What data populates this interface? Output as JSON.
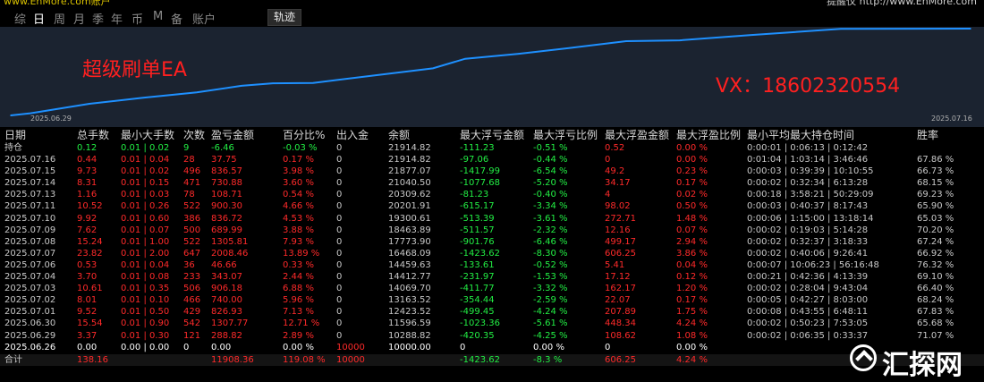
{
  "top": {
    "left_text": "www.EnMore.com账户",
    "right_text": "提醒仪 http://www.EnMore.com",
    "tabs": [
      "综",
      "日",
      "周",
      "月",
      "季",
      "年",
      "币",
      "M",
      "备",
      "账户"
    ],
    "active_tab": "日",
    "track_button": "轨迹"
  },
  "chart": {
    "title": "超级刷单EA",
    "contact": "VX：18602320554",
    "start_date": "2025.06.29",
    "end_date": "2025.07.16"
  },
  "chart_data": {
    "type": "line",
    "series": [
      {
        "values": [
          10000.0,
          10288.82,
          11596.59,
          12423.52,
          13163.52,
          14069.7,
          14412.77,
          14459.63,
          16468.09,
          17773.9,
          18463.89,
          19300.61,
          20201.91,
          20309.62,
          21040.5,
          21877.07,
          21914.82
        ]
      }
    ],
    "x": [
      "2025.06.26",
      "2025.06.29",
      "2025.06.30",
      "2025.07.01",
      "2025.07.02",
      "2025.07.03",
      "2025.07.04",
      "2025.07.06",
      "2025.07.07",
      "2025.07.08",
      "2025.07.09",
      "2025.07.10",
      "2025.07.11",
      "2025.07.13",
      "2025.07.14",
      "2025.07.15",
      "2025.07.16"
    ]
  },
  "table": {
    "headers": [
      "日期",
      "总手数",
      "最小大手数",
      "次数",
      "盈亏金额",
      "百分比%",
      "出入金",
      "余额",
      "最大浮亏金额",
      "最大浮亏比例",
      "最大浮盈金额",
      "最大浮盈比例",
      "最小平均最大持仓时间",
      "胜率"
    ],
    "holding": [
      "持仓",
      "0.12",
      "0.01 | 0.02",
      "9",
      "-6.46",
      "-0.03 %",
      "0",
      "21914.82",
      "-111.23",
      "-0.51 %",
      "0.52",
      "0.00 %",
      "0:00:01 | 0:06:13 | 0:12:42",
      ""
    ],
    "rows": [
      [
        "2025.07.16",
        "0.44",
        "0.01 | 0.04",
        "28",
        "37.75",
        "0.17 %",
        "0",
        "21914.82",
        "-97.06",
        "-0.44 %",
        "0",
        "0.00 %",
        "0:01:04 | 1:03:14 | 3:46:46",
        "67.86 %"
      ],
      [
        "2025.07.15",
        "9.73",
        "0.01 | 0.02",
        "496",
        "836.57",
        "3.98 %",
        "0",
        "21877.07",
        "-1417.99",
        "-6.54 %",
        "49.2",
        "0.23 %",
        "0:00:03 | 0:39:39 | 10:10:55",
        "66.73 %"
      ],
      [
        "2025.07.14",
        "8.31",
        "0.01 | 0.15",
        "471",
        "730.88",
        "3.60 %",
        "0",
        "21040.50",
        "-1077.68",
        "-5.20 %",
        "34.17",
        "0.17 %",
        "0:00:02 | 0:32:34 | 6:13:28",
        "68.15 %"
      ],
      [
        "2025.07.13",
        "1.16",
        "0.01 | 0.03",
        "78",
        "108.71",
        "0.54 %",
        "0",
        "20309.62",
        "-81.23",
        "-0.40 %",
        "4",
        "0.02 %",
        "0:00:18 | 3:58:21 | 50:29:09",
        "69.23 %"
      ],
      [
        "2025.07.11",
        "10.52",
        "0.01 | 0.26",
        "522",
        "900.30",
        "4.66 %",
        "0",
        "20201.91",
        "-615.17",
        "-3.34 %",
        "98.02",
        "0.50 %",
        "0:00:03 | 0:40:37 | 8:17:43",
        "65.90 %"
      ],
      [
        "2025.07.10",
        "9.92",
        "0.01 | 0.60",
        "386",
        "836.72",
        "4.53 %",
        "0",
        "19300.61",
        "-513.39",
        "-3.61 %",
        "272.71",
        "1.48 %",
        "0:00:06 | 1:15:00 | 13:18:14",
        "65.03 %"
      ],
      [
        "2025.07.09",
        "7.62",
        "0.01 | 0.07",
        "500",
        "689.99",
        "3.88 %",
        "0",
        "18463.89",
        "-511.57",
        "-2.32 %",
        "12.16",
        "0.07 %",
        "0:00:02 | 0:19:03 | 5:14:28",
        "70.20 %"
      ],
      [
        "2025.07.08",
        "15.24",
        "0.01 | 1.00",
        "522",
        "1305.81",
        "7.93 %",
        "0",
        "17773.90",
        "-901.76",
        "-6.46 %",
        "499.17",
        "2.94 %",
        "0:00:02 | 0:32:37 | 3:18:33",
        "67.24 %"
      ],
      [
        "2025.07.07",
        "23.82",
        "0.01 | 2.00",
        "647",
        "2008.46",
        "13.89 %",
        "0",
        "16468.09",
        "-1423.62",
        "-8.30 %",
        "606.25",
        "3.86 %",
        "0:00:02 | 0:40:06 | 9:26:41",
        "66.92 %"
      ],
      [
        "2025.07.06",
        "0.53",
        "0.01 | 0.04",
        "36",
        "46.66",
        "0.33 %",
        "0",
        "14459.63",
        "-133.61",
        "-0.52 %",
        "5.41",
        "0.04 %",
        "0:00:07 | 10:06:23 | 56:16:48",
        "76.32 %"
      ],
      [
        "2025.07.04",
        "3.70",
        "0.01 | 0.08",
        "233",
        "343.07",
        "2.44 %",
        "0",
        "14412.77",
        "-231.97",
        "-1.53 %",
        "17.12",
        "0.12 %",
        "0:00:21 | 0:42:36 | 4:13:39",
        "69.10 %"
      ],
      [
        "2025.07.03",
        "10.61",
        "0.01 | 0.35",
        "506",
        "906.18",
        "6.88 %",
        "0",
        "14069.70",
        "-411.77",
        "-3.32 %",
        "162.17",
        "1.20 %",
        "0:00:02 | 0:28:04 | 9:43:04",
        "66.40 %"
      ],
      [
        "2025.07.02",
        "8.01",
        "0.01 | 0.10",
        "466",
        "740.00",
        "5.96 %",
        "0",
        "13163.52",
        "-354.44",
        "-2.59 %",
        "22.07",
        "0.17 %",
        "0:00:05 | 0:42:27 | 8:03:00",
        "68.24 %"
      ],
      [
        "2025.07.01",
        "9.52",
        "0.01 | 0.50",
        "429",
        "826.93",
        "7.13 %",
        "0",
        "12423.52",
        "-499.45",
        "-4.24 %",
        "207.89",
        "1.75 %",
        "0:00:08 | 0:43:55 | 6:48:11",
        "67.83 %"
      ],
      [
        "2025.06.30",
        "15.54",
        "0.01 | 0.90",
        "542",
        "1307.77",
        "12.71 %",
        "0",
        "11596.59",
        "-1023.36",
        "-5.61 %",
        "448.34",
        "4.24 %",
        "0:00:02 | 0:50:23 | 7:53:05",
        "65.68 %"
      ],
      [
        "2025.06.29",
        "3.37",
        "0.01 | 0.30",
        "121",
        "288.82",
        "2.89 %",
        "0",
        "10288.82",
        "-420.35",
        "-4.25 %",
        "108.62",
        "1.08 %",
        "0:00:02 | 0:06:35 | 0:33:37",
        "71.07 %"
      ],
      [
        "2025.06.26",
        "0.00",
        "0.00 | 0.00",
        "0",
        "0.00",
        "0.00 %",
        "10000",
        "10000.00",
        "0",
        "0.00 %",
        "0",
        "0.00 %",
        "",
        ""
      ]
    ],
    "total": [
      "合计",
      "138.16",
      "",
      "",
      "11908.36",
      "119.08 %",
      "10000",
      "",
      "-1423.62",
      "-8.3 %",
      "606.25",
      "4.24 %",
      "",
      ""
    ]
  },
  "watermark": "汇探网",
  "colors": {
    "red": "#ff2a2a",
    "green": "#22ee44",
    "chart_bg": "#1b2330",
    "line": "#1e90ff"
  }
}
